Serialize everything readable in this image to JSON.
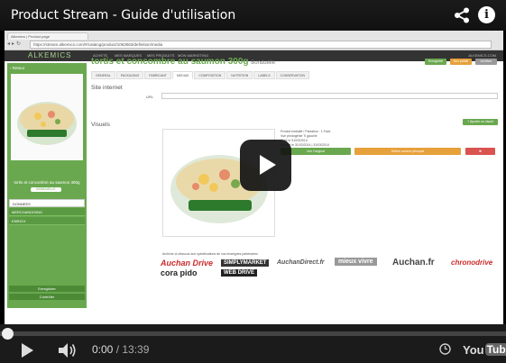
{
  "player": {
    "title": "Product Stream - Guide d'utilisation",
    "share_icon": "share-icon",
    "info_label": "i",
    "current_time": "0:00",
    "time_separator": " / ",
    "duration": "13:39",
    "progress_fraction": 0.0,
    "youtube_you": "You",
    "youtube_tube": "Tube"
  },
  "browser": {
    "tab_title": "Alkemics | Product page",
    "url": "https://stream.alkemics.com/#/catalog/product/1063063/definition/media"
  },
  "app": {
    "logo": "ALKEMICS",
    "nav": [
      "ACHETE",
      "MES MARQUES",
      "MES PRODUITS",
      "MON MARKETING"
    ],
    "user": "ALKEMICS.COM"
  },
  "product": {
    "back": "‹ Retour",
    "title": "tortis et concombre au saumon 300g",
    "brand": "Bonduelle",
    "caption": "tortis et concombre au saumon 300g",
    "caption_badge": "BONDUELLE",
    "top_buttons": [
      "Enregistré",
      "Non publié",
      "Archiver"
    ],
    "tabs": [
      "GENERAL",
      "PACKAGING",
      "FABRICANT",
      "MEDIAS",
      "COMPOSITION",
      "NUTRITION",
      "LABELS",
      "CONSERVATION"
    ],
    "active_tab": "MEDIAS"
  },
  "left_menu": {
    "items": [
      "DONNEES",
      "MERCHANDISING",
      "ENRICH"
    ],
    "buttons": [
      "Enregistrer",
      "Contrôler"
    ]
  },
  "site": {
    "title": "Site internet",
    "url_label": "URL",
    "url_value": ""
  },
  "visuals": {
    "title": "Visuels",
    "add_button": "+ Ajouter un visuel",
    "meta": [
      "Produit emballé / Paniation : 1 Face",
      "Vue photogénie Ti gauche",
      "Créé le 31/03/2014",
      "Modifié le 31/03/2014 | 31/03/2014"
    ],
    "buttons": [
      "Voir l'original",
      "Définir comme principal",
      "✖"
    ]
  },
  "retailers": {
    "note": "Archiver ci-dessous aux spécifications de vos enseignes partenaires",
    "logos": [
      "Auchan Drive",
      "SIMPLYMARKET",
      "AuchanDirect.fr",
      "mieux vivre",
      "Auchan.fr",
      "chronodrive",
      "cora pido",
      "WEB DRIVE"
    ]
  },
  "colors": {
    "accent_green": "#6aa84f",
    "progress_red": "#cc0000",
    "retail_red": "#cc2a2a"
  }
}
